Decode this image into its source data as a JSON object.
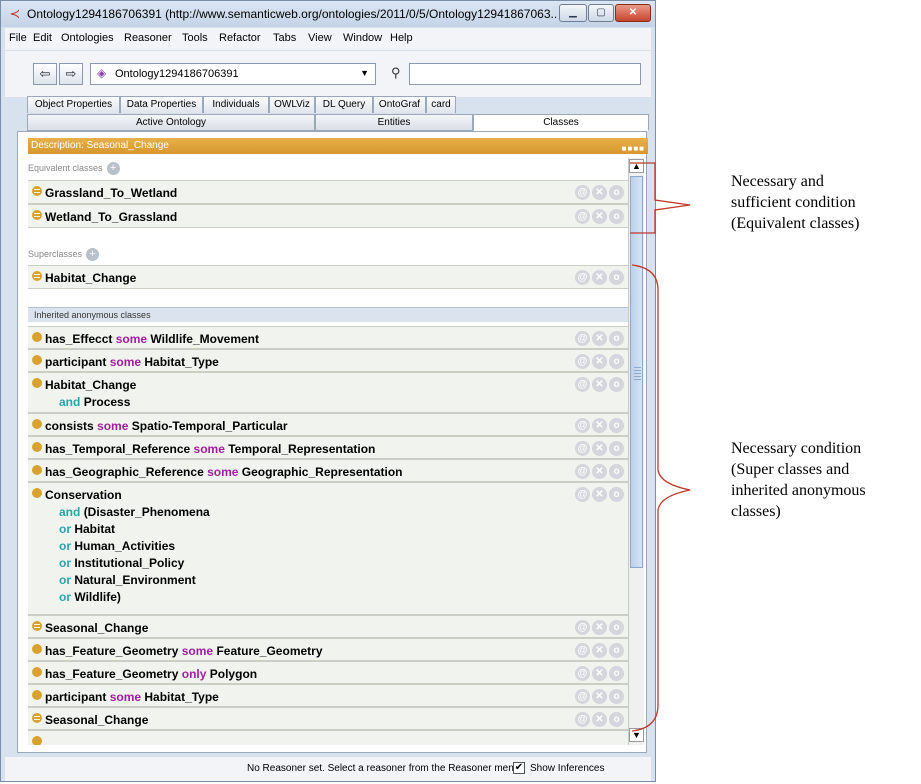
{
  "window": {
    "title": "Ontology1294186706391 (http://www.semanticweb.org/ontologies/2011/0/5/Ontology12941867063..."
  },
  "menu": [
    "File",
    "Edit",
    "Ontologies",
    "Reasoner",
    "Tools",
    "Refactor",
    "Tabs",
    "View",
    "Window",
    "Help"
  ],
  "toolbar": {
    "ontology": "Ontology1294186706391",
    "search_value": ""
  },
  "tabs_top": [
    "Object Properties",
    "Data Properties",
    "Individuals",
    "OWLViz",
    "DL Query",
    "OntoGraf",
    "card"
  ],
  "tabs_bottom": [
    "Active Ontology",
    "Entities",
    "Classes"
  ],
  "description": {
    "title": "Description: Seasonal_Change"
  },
  "sections": {
    "equivalent": "Equivalent classes",
    "superclasses": "Superclasses",
    "inherited": "Inherited anonymous classes"
  },
  "equivalent_rows": [
    {
      "name": "Grassland_To_Wetland"
    },
    {
      "name": "Wetland_To_Grassland"
    }
  ],
  "superclass_rows": [
    {
      "name": "Habitat_Change"
    }
  ],
  "inherited_rows": [
    {
      "a": "has_Effecct",
      "kw": "some",
      "b": "Wildlife_Movement"
    },
    {
      "a": "participant",
      "kw": "some",
      "b": "Habitat_Type"
    },
    {
      "a": "Habitat_Change",
      "l2kw": "and",
      "l2": "Process"
    },
    {
      "a": "consists",
      "kw": "some",
      "b": "Spatio-Temporal_Particular"
    },
    {
      "a": "has_Temporal_Reference",
      "kw": "some",
      "b": "Temporal_Representation"
    },
    {
      "a": "has_Geographic_Reference",
      "kw": "some",
      "b": "Geographic_Representation"
    },
    {
      "a": "Conservation",
      "l2kw": "and",
      "l2": "(Disaster_Phenomena",
      "l3kw": "or",
      "l3": "Habitat",
      "l4kw": "or",
      "l4": "Human_Activities",
      "l5kw": "or",
      "l5": "Institutional_Policy",
      "l6kw": "or",
      "l6": "Natural_Environment",
      "l7kw": "or",
      "l7": "Wildlife)"
    },
    {
      "a": "Seasonal_Change"
    },
    {
      "a": "has_Feature_Geometry",
      "kw": "some",
      "b": "Feature_Geometry"
    },
    {
      "a": "has_Feature_Geometry",
      "kw": "only",
      "b": "Polygon"
    },
    {
      "a": "participant",
      "kw": "some",
      "b": "Habitat_Type"
    },
    {
      "a": "Seasonal_Change"
    }
  ],
  "row_action_icons": {
    "at": "@",
    "remove": "✕",
    "edit": "o"
  },
  "status": {
    "message": "No Reasoner set. Select a reasoner from the Reasoner menu",
    "show_inferences": "Show Inferences"
  },
  "annotations": {
    "nsc": [
      "Necessary and",
      "sufficient condition",
      "(Equivalent classes)"
    ],
    "nc": [
      "Necessary condition",
      "(Super classes and",
      "inherited anonymous",
      "classes)"
    ]
  },
  "colors": {
    "desc_bar": "#d6972e",
    "keyword_some": "#a020a0",
    "keyword_and_or": "#2aa5a8",
    "bullet": "#d8a22e"
  }
}
